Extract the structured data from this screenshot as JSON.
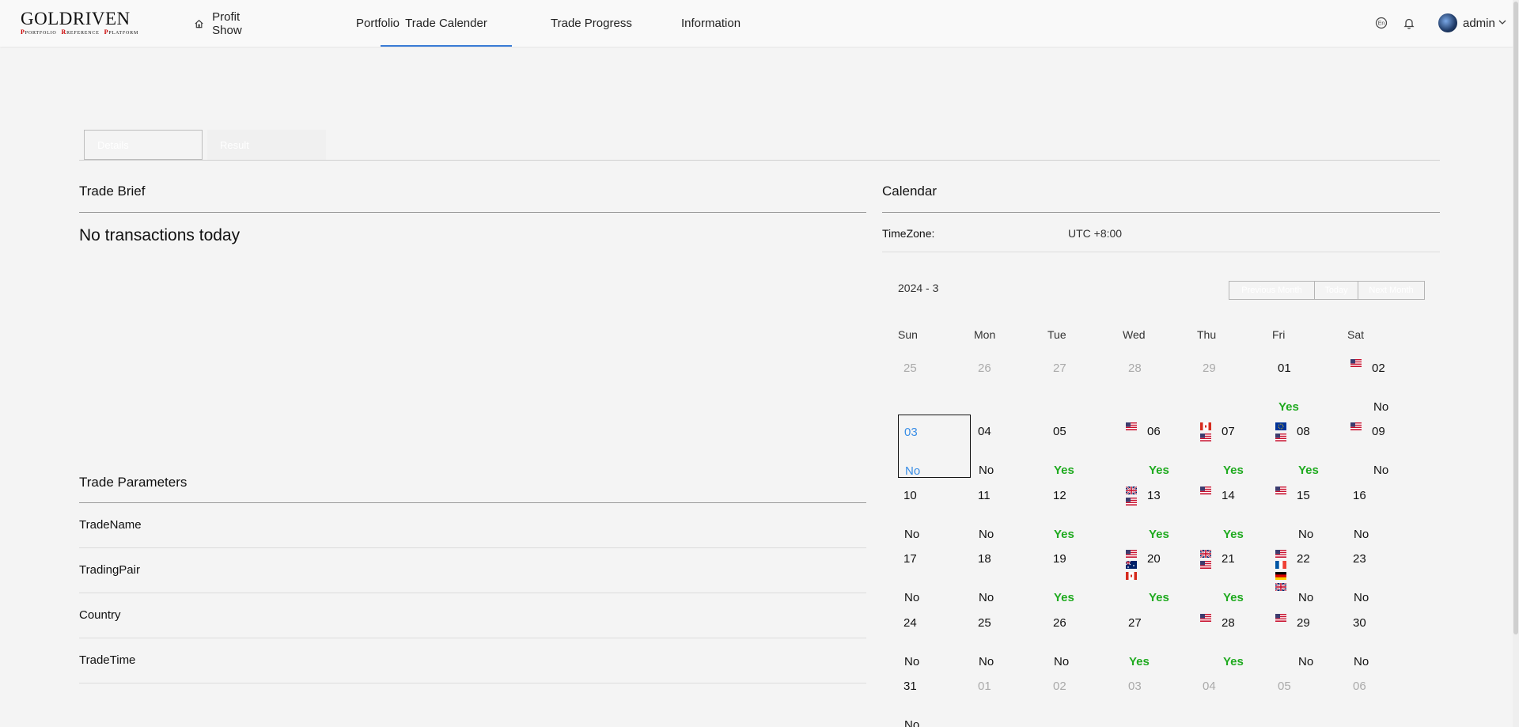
{
  "header": {
    "logo_main": "GOLDRIVEN",
    "logo_sub": [
      "PORTFOLIO",
      "REFERENCE",
      "PLATFORM"
    ],
    "nav": [
      {
        "label": "Profit Show",
        "icon": "home-icon"
      },
      {
        "label": "Portfolio"
      },
      {
        "label": "Trade Calender",
        "active": true
      },
      {
        "label": "Trade Progress"
      },
      {
        "label": "Information"
      }
    ],
    "user": "admin",
    "accent": "#3a7bd5"
  },
  "tabs": {
    "details": "Details",
    "result": "Result"
  },
  "brief": {
    "title": "Trade Brief",
    "empty": "No transactions today"
  },
  "params": {
    "title": "Trade Parameters",
    "rows": [
      "TradeName",
      "TradingPair",
      "Country",
      "TradeTime"
    ]
  },
  "calendar": {
    "title": "Calendar",
    "tz_label": "TimeZone:",
    "tz_value": "UTC +8:00",
    "month": "2024 - 3",
    "buttons": {
      "prev": "Previous Month",
      "today": "Today",
      "next": "Next Month"
    },
    "days": [
      "Sun",
      "Mon",
      "Tue",
      "Wed",
      "Thu",
      "Fri",
      "Sat"
    ],
    "yes_color": "#1faa1f",
    "weeks": [
      [
        {
          "d": "25",
          "m": true
        },
        {
          "d": "26",
          "m": true
        },
        {
          "d": "27",
          "m": true
        },
        {
          "d": "28",
          "m": true
        },
        {
          "d": "29",
          "m": true
        },
        {
          "d": "01",
          "s": "Yes"
        },
        {
          "d": "02",
          "s": "No",
          "f": [
            "us"
          ]
        }
      ],
      [
        {
          "d": "03",
          "s": "No",
          "sel": true
        },
        {
          "d": "04",
          "s": "No"
        },
        {
          "d": "05",
          "s": "Yes"
        },
        {
          "d": "06",
          "s": "Yes",
          "f": [
            "us"
          ]
        },
        {
          "d": "07",
          "s": "Yes",
          "f": [
            "ca",
            "us"
          ]
        },
        {
          "d": "08",
          "s": "Yes",
          "f": [
            "eu",
            "us"
          ]
        },
        {
          "d": "09",
          "s": "No",
          "f": [
            "us"
          ]
        }
      ],
      [
        {
          "d": "10",
          "s": "No"
        },
        {
          "d": "11",
          "s": "No"
        },
        {
          "d": "12",
          "s": "Yes"
        },
        {
          "d": "13",
          "s": "Yes",
          "f": [
            "gb",
            "us"
          ]
        },
        {
          "d": "14",
          "s": "Yes",
          "f": [
            "us"
          ]
        },
        {
          "d": "15",
          "s": "No",
          "f": [
            "us"
          ]
        },
        {
          "d": "16",
          "s": "No"
        }
      ],
      [
        {
          "d": "17",
          "s": "No"
        },
        {
          "d": "18",
          "s": "No"
        },
        {
          "d": "19",
          "s": "Yes"
        },
        {
          "d": "20",
          "s": "Yes",
          "f": [
            "us",
            "au",
            "ca"
          ]
        },
        {
          "d": "21",
          "s": "Yes",
          "f": [
            "gb",
            "us"
          ]
        },
        {
          "d": "22",
          "s": "No",
          "f": [
            "us",
            "fr",
            "de",
            "gb"
          ]
        },
        {
          "d": "23",
          "s": "No"
        }
      ],
      [
        {
          "d": "24",
          "s": "No"
        },
        {
          "d": "25",
          "s": "No"
        },
        {
          "d": "26",
          "s": "No"
        },
        {
          "d": "27",
          "s": "Yes"
        },
        {
          "d": "28",
          "s": "Yes",
          "f": [
            "us"
          ]
        },
        {
          "d": "29",
          "s": "No",
          "f": [
            "us"
          ]
        },
        {
          "d": "30",
          "s": "No"
        }
      ],
      [
        {
          "d": "31",
          "s": "No"
        },
        {
          "d": "01",
          "m": true
        },
        {
          "d": "02",
          "m": true
        },
        {
          "d": "03",
          "m": true
        },
        {
          "d": "04",
          "m": true
        },
        {
          "d": "05",
          "m": true
        },
        {
          "d": "06",
          "m": true
        }
      ]
    ]
  }
}
